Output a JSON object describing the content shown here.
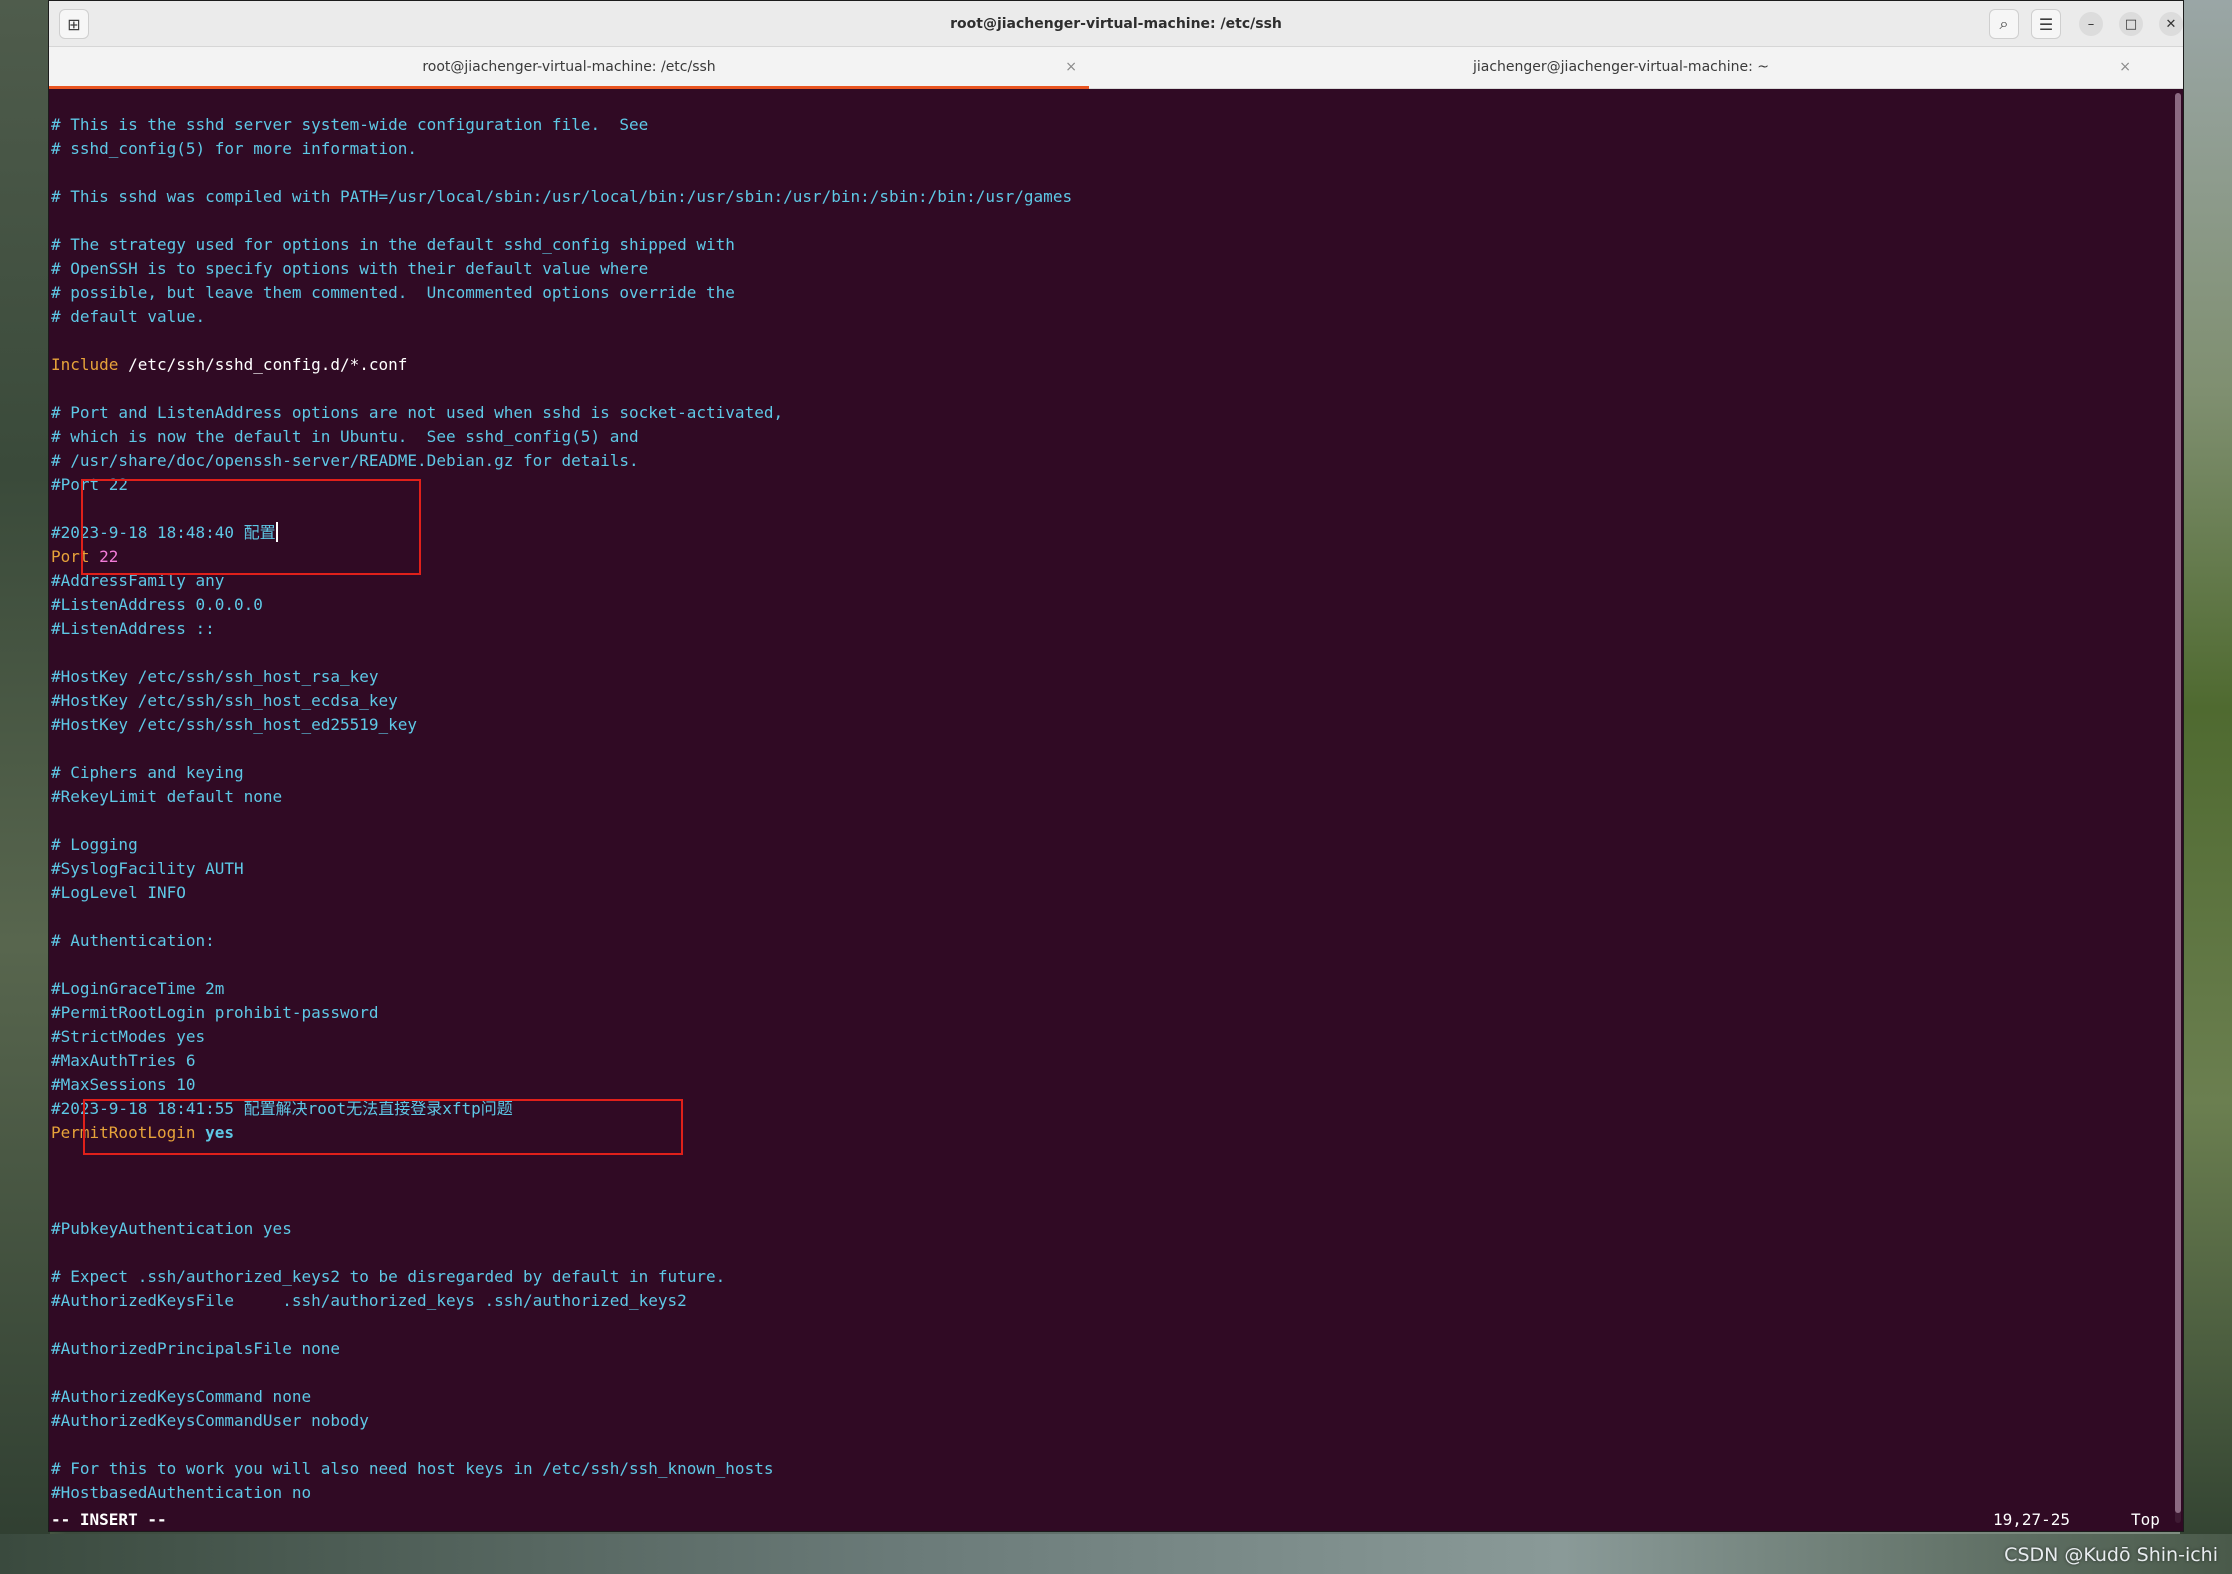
{
  "window": {
    "title": "root@jiachenger-virtual-machine: /etc/ssh"
  },
  "tabs": [
    {
      "label": "root@jiachenger-virtual-machine: /etc/ssh",
      "active": true
    },
    {
      "label": "jiachenger@jiachenger-virtual-machine: ~",
      "active": false
    }
  ],
  "icons": {
    "new_tab": "new-tab-icon",
    "search": "search-icon",
    "menu": "hamburger-menu-icon",
    "minimize": "minimize-icon",
    "maximize": "maximize-icon",
    "close": "close-icon",
    "tab_close": "close-icon",
    "tabs_dropdown": "chevron-down-icon"
  },
  "glyphs": {
    "new_tab": "⊞",
    "search": "⌕",
    "menu": "☰",
    "minimize": "–",
    "maximize": "□",
    "close": "✕",
    "tab_close": "×",
    "chevron": "⌄"
  },
  "colors": {
    "terminal_bg": "#300a24",
    "comment": "#5ec8e6",
    "keyword": "#e7a33a",
    "number": "#f27bd8",
    "tab_accent": "#e95420",
    "highlight_box": "#e0201a"
  },
  "editor": {
    "lines": [
      {
        "type": "comment",
        "text": "# This is the sshd server system-wide configuration file.  See"
      },
      {
        "type": "comment",
        "text": "# sshd_config(5) for more information."
      },
      {
        "type": "blank",
        "text": ""
      },
      {
        "type": "comment",
        "text": "# This sshd was compiled with PATH=/usr/local/sbin:/usr/local/bin:/usr/sbin:/usr/bin:/sbin:/bin:/usr/games"
      },
      {
        "type": "blank",
        "text": ""
      },
      {
        "type": "comment",
        "text": "# The strategy used for options in the default sshd_config shipped with"
      },
      {
        "type": "comment",
        "text": "# OpenSSH is to specify options with their default value where"
      },
      {
        "type": "comment",
        "text": "# possible, but leave them commented.  Uncommented options override the"
      },
      {
        "type": "comment",
        "text": "# default value."
      },
      {
        "type": "blank",
        "text": ""
      },
      {
        "type": "directive",
        "keyword": "Include",
        "value": " /etc/ssh/sshd_config.d/*.conf"
      },
      {
        "type": "blank",
        "text": ""
      },
      {
        "type": "comment",
        "text": "# Port and ListenAddress options are not used when sshd is socket-activated,"
      },
      {
        "type": "comment",
        "text": "# which is now the default in Ubuntu.  See sshd_config(5) and"
      },
      {
        "type": "comment",
        "text": "# /usr/share/doc/openssh-server/README.Debian.gz for details."
      },
      {
        "type": "comment",
        "text": "#Port 22"
      },
      {
        "type": "blank",
        "text": ""
      },
      {
        "type": "comment-cursor",
        "text": "#2023-9-18 18:48:40 配置"
      },
      {
        "type": "port",
        "keyword": "Port",
        "value": " 22"
      },
      {
        "type": "comment",
        "text": "#AddressFamily any"
      },
      {
        "type": "comment",
        "text": "#ListenAddress 0.0.0.0"
      },
      {
        "type": "comment",
        "text": "#ListenAddress ::"
      },
      {
        "type": "blank",
        "text": ""
      },
      {
        "type": "comment",
        "text": "#HostKey /etc/ssh/ssh_host_rsa_key"
      },
      {
        "type": "comment",
        "text": "#HostKey /etc/ssh/ssh_host_ecdsa_key"
      },
      {
        "type": "comment",
        "text": "#HostKey /etc/ssh/ssh_host_ed25519_key"
      },
      {
        "type": "blank",
        "text": ""
      },
      {
        "type": "comment",
        "text": "# Ciphers and keying"
      },
      {
        "type": "comment",
        "text": "#RekeyLimit default none"
      },
      {
        "type": "blank",
        "text": ""
      },
      {
        "type": "comment",
        "text": "# Logging"
      },
      {
        "type": "comment",
        "text": "#SyslogFacility AUTH"
      },
      {
        "type": "comment",
        "text": "#LogLevel INFO"
      },
      {
        "type": "blank",
        "text": ""
      },
      {
        "type": "comment",
        "text": "# Authentication:"
      },
      {
        "type": "blank",
        "text": ""
      },
      {
        "type": "comment",
        "text": "#LoginGraceTime 2m"
      },
      {
        "type": "comment",
        "text": "#PermitRootLogin prohibit-password"
      },
      {
        "type": "comment",
        "text": "#StrictModes yes"
      },
      {
        "type": "comment",
        "text": "#MaxAuthTries 6"
      },
      {
        "type": "comment",
        "text": "#MaxSessions 10"
      },
      {
        "type": "comment",
        "text": "#2023-9-18 18:41:55 配置解决root无法直接登录xftp问题"
      },
      {
        "type": "permit",
        "keyword": "PermitRootLogin",
        "value": "yes"
      },
      {
        "type": "blank",
        "text": ""
      },
      {
        "type": "blank",
        "text": ""
      },
      {
        "type": "blank",
        "text": ""
      },
      {
        "type": "comment",
        "text": "#PubkeyAuthentication yes"
      },
      {
        "type": "blank",
        "text": ""
      },
      {
        "type": "comment",
        "text": "# Expect .ssh/authorized_keys2 to be disregarded by default in future."
      },
      {
        "type": "comment",
        "text": "#AuthorizedKeysFile     .ssh/authorized_keys .ssh/authorized_keys2"
      },
      {
        "type": "blank",
        "text": ""
      },
      {
        "type": "comment",
        "text": "#AuthorizedPrincipalsFile none"
      },
      {
        "type": "blank",
        "text": ""
      },
      {
        "type": "comment",
        "text": "#AuthorizedKeysCommand none"
      },
      {
        "type": "comment",
        "text": "#AuthorizedKeysCommandUser nobody"
      },
      {
        "type": "blank",
        "text": ""
      },
      {
        "type": "comment",
        "text": "# For this to work you will also need host keys in /etc/ssh/ssh_known_hosts"
      },
      {
        "type": "comment",
        "text": "#HostbasedAuthentication no"
      }
    ]
  },
  "status": {
    "mode": "-- INSERT --",
    "position": "19,27-25",
    "scroll": "Top"
  },
  "watermark": "CSDN @Kudō Shin-ichi"
}
